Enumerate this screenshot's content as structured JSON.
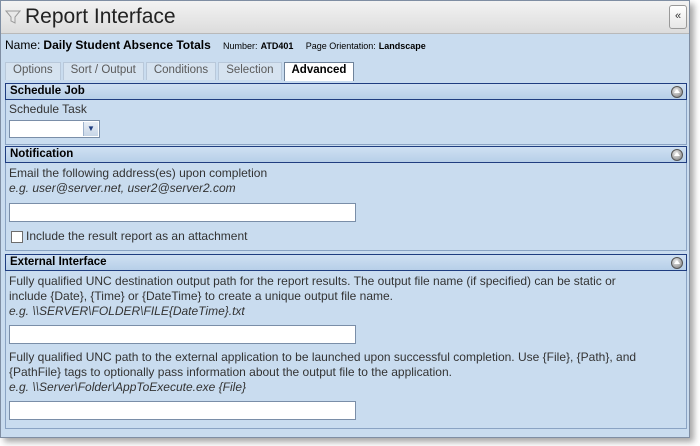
{
  "window": {
    "title": "Report Interface",
    "collapse_label": "«"
  },
  "report": {
    "name_label": "Name:",
    "name": "Daily Student Absence Totals",
    "number_label": "Number:",
    "number": "ATD401",
    "orientation_label": "Page Orientation:",
    "orientation": "Landscape"
  },
  "tabs": [
    {
      "label": "Options"
    },
    {
      "label": "Sort / Output"
    },
    {
      "label": "Conditions"
    },
    {
      "label": "Selection"
    },
    {
      "label": "Advanced",
      "active": true
    }
  ],
  "schedule_job": {
    "header": "Schedule Job",
    "task_label": "Schedule Task",
    "task_value": ""
  },
  "notification": {
    "header": "Notification",
    "description": "Email the following address(es) upon completion",
    "example": "e.g. user@server.net, user2@server2.com",
    "email_value": "",
    "attachment_label": "Include the result report as an attachment",
    "attachment_checked": false
  },
  "external_interface": {
    "header": "External Interface",
    "output_desc_line1": "Fully qualified UNC destination output path for the report results. The output file name (if specified) can be static or",
    "output_desc_line2": "include {Date}, {Time} or {DateTime} to create a unique output file name.",
    "output_example": "e.g. \\\\SERVER\\FOLDER\\FILE{DateTime}.txt",
    "output_value": "",
    "app_desc_line1": "Fully qualified UNC path to the external application to be launched upon successful completion. Use {File}, {Path}, and",
    "app_desc_line2": "{PathFile} tags to optionally pass information about the output file to the application.",
    "app_example": "e.g. \\\\Server\\Folder\\AppToExecute.exe {File}",
    "app_value": ""
  },
  "colors": {
    "panel": "#c9dcef",
    "header_border": "#1f3d80"
  },
  "icons": [
    "funnel-icon",
    "collapse-icon",
    "section-caret-icon",
    "dropdown-arrow-icon"
  ]
}
